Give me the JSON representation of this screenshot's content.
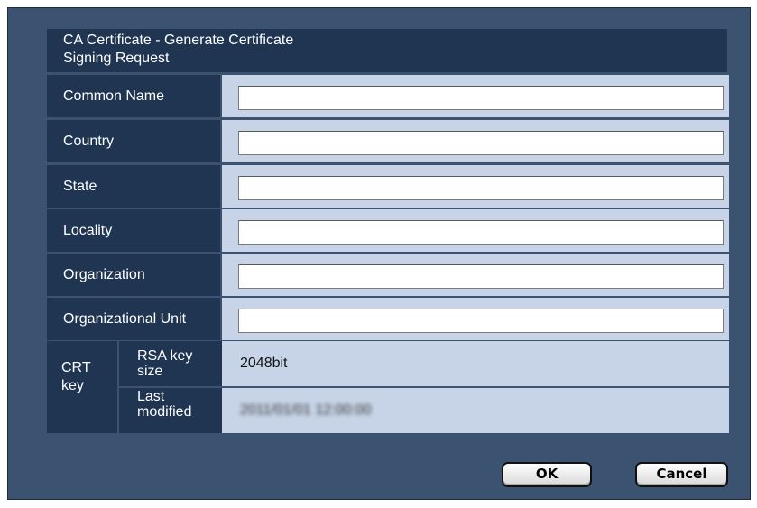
{
  "dialog": {
    "title_line1": "CA Certificate - Generate Certificate",
    "title_line2": "Signing Request"
  },
  "fields": [
    {
      "label": "Common Name",
      "value": ""
    },
    {
      "label": "Country",
      "value": ""
    },
    {
      "label": "State",
      "value": ""
    },
    {
      "label": "Locality",
      "value": ""
    },
    {
      "label": "Organization",
      "value": ""
    },
    {
      "label": "Organizational Unit",
      "value": ""
    }
  ],
  "crt_key": {
    "label_line1": "CRT",
    "label_line2": "key",
    "rsa_label_line1": "RSA key",
    "rsa_label_line2": "size",
    "rsa_value": "2048bit",
    "modified_label_line1": "Last",
    "modified_label_line2": "modified",
    "modified_value": "2011/01/01 12:00:00"
  },
  "buttons": {
    "ok": "OK",
    "cancel": "Cancel"
  },
  "colors": {
    "dialog_bg": "#3b5271",
    "label_bg": "#1f3552",
    "cell_bg": "#c7d4e7"
  }
}
